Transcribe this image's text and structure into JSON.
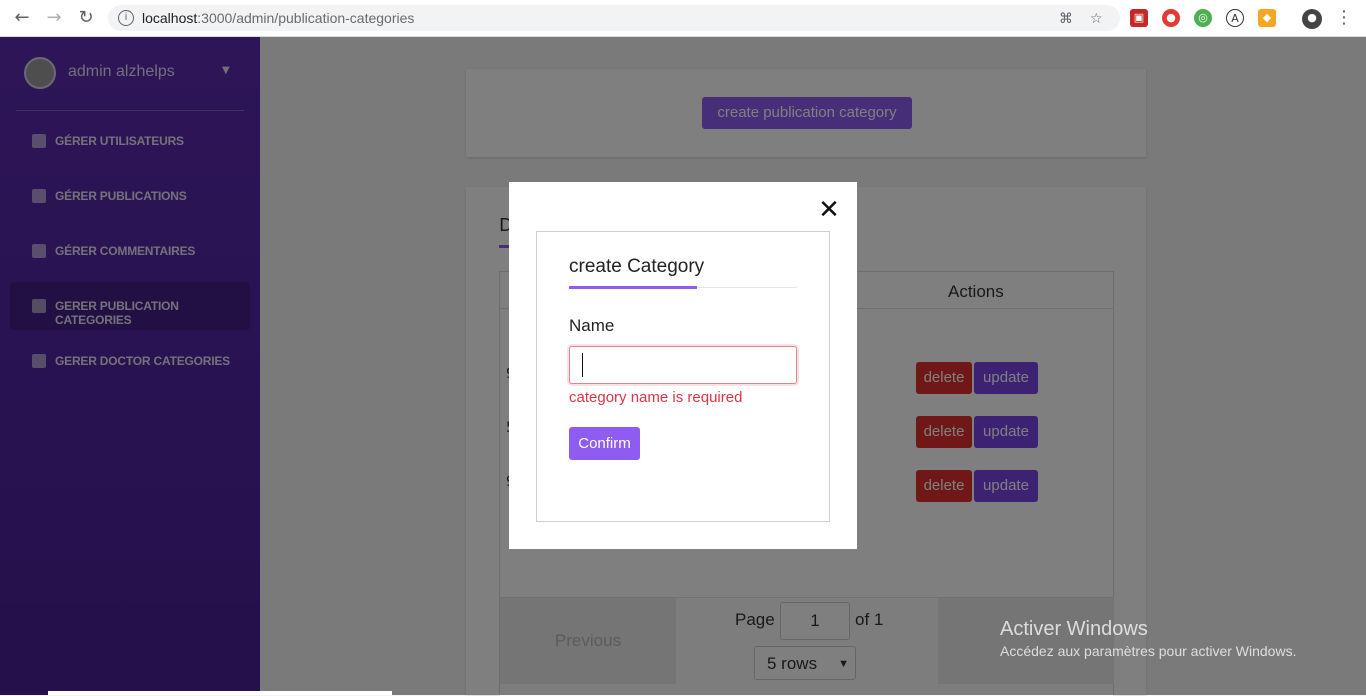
{
  "browser": {
    "url_host": "localhost",
    "url_port_path": ":3000/admin/publication-categories",
    "info_glyph": "i"
  },
  "sidebar": {
    "user_name": "admin alzhelps",
    "items": [
      {
        "label": "GÉRER UTILISATEURS"
      },
      {
        "label": "GÉRER PUBLICATIONS"
      },
      {
        "label": "GÉRER COMMENTAIRES"
      },
      {
        "label": "GERER PUBLICATION CATEGORIES",
        "active": true
      },
      {
        "label": "GERER DOCTOR CATEGORIES"
      }
    ]
  },
  "main": {
    "create_button": "create publication category",
    "tab_first_letter": "D",
    "table": {
      "actions_header": "Actions",
      "rows": [
        {
          "id_fragment": "9",
          "delete": "delete",
          "update": "update"
        },
        {
          "id_fragment": "5",
          "delete": "delete",
          "update": "update"
        },
        {
          "id_fragment": "9",
          "delete": "delete",
          "update": "update"
        }
      ]
    },
    "pagination": {
      "previous": "Previous",
      "page_label": "Page",
      "page_value": "1",
      "of_label": "of 1",
      "rows_option": "5 rows"
    }
  },
  "modal": {
    "title": "create Category",
    "name_label": "Name",
    "name_value": "",
    "error": "category name is required",
    "confirm": "Confirm"
  },
  "watermark": {
    "title": "Activer Windows",
    "subtitle": "Accédez aux paramètres pour activer Windows."
  },
  "colors": {
    "sidebar": "#4f239e",
    "accent": "#8e5cf0",
    "danger": "#e03131",
    "error_text": "#dc3545"
  }
}
